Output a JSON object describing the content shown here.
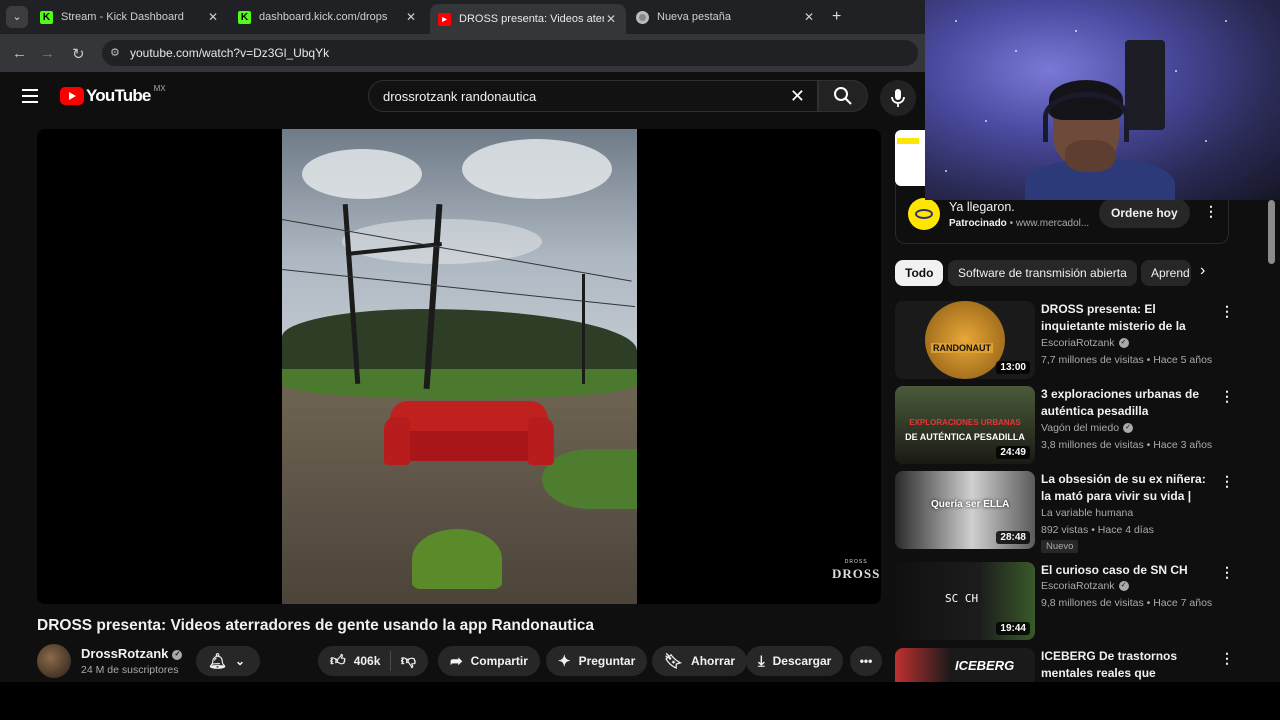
{
  "browser": {
    "tabs": [
      {
        "title": "Stream - Kick Dashboard",
        "favicon": "kick-icon",
        "active": false
      },
      {
        "title": "dashboard.kick.com/drops",
        "favicon": "kick-icon",
        "active": false
      },
      {
        "title": "DROSS presenta: Videos aterradores",
        "favicon": "youtube-icon",
        "active": true
      },
      {
        "title": "Nueva pestaña",
        "favicon": "chrome-icon",
        "active": false
      }
    ],
    "url": "youtube.com/watch?v=Dz3Gl_UbqYk"
  },
  "youtube": {
    "logo_text": "YouTube",
    "country_code": "MX",
    "search_query": "drossrotzank randonautica",
    "video": {
      "title": "DROSS presenta: Videos aterradores de gente usando la app Randonautica",
      "channel": "DrossRotzank",
      "subscribers": "24 M de suscriptores",
      "likes": "406k",
      "watermark_small": "DROSS",
      "watermark_big": "DROSS"
    },
    "actions": {
      "share": "Compartir",
      "ask": "Preguntar",
      "save": "Ahorrar",
      "download": "Descargar"
    },
    "ad": {
      "title": "Ya llegaron.",
      "sponsored": "Patrocinado",
      "domain": "www.mercadol...",
      "cta": "Ordene hoy"
    },
    "chips": [
      "Todo",
      "Software de transmisión abierta",
      "Aprend"
    ],
    "recommendations": [
      {
        "title": "DROSS presenta: El inquietante misterio de la aplicación ...",
        "channel": "EscoriaRotzank",
        "verified": true,
        "meta": "7,7 millones de visitas • Hace 5 años",
        "duration": "13:00",
        "badge": ""
      },
      {
        "title": "3 exploraciones urbanas de auténtica pesadilla",
        "channel": "Vagón del miedo",
        "verified": true,
        "meta": "3,8 millones de visitas • Hace 3 años",
        "duration": "24:49",
        "badge": ""
      },
      {
        "title": "La obsesión de su ex niñera: la mató para vivir su vida | Caso ...",
        "channel": "La variable humana",
        "verified": false,
        "meta": "892 vistas • Hace 4 días",
        "duration": "28:48",
        "badge": "Nuevo"
      },
      {
        "title": "El curioso caso de SN CH",
        "channel": "EscoriaRotzank",
        "verified": true,
        "meta": "9,8 millones de visitas • Hace 7 años",
        "duration": "19:44",
        "badge": ""
      },
      {
        "title": "ICEBERG De trastornos mentales reales que destruyen...",
        "channel": "",
        "verified": false,
        "meta": "",
        "duration": "",
        "badge": ""
      }
    ],
    "thumb_texts": {
      "t1_top": "RANDONAUT",
      "t2_top": "EXPLORACIONES URBANAS",
      "t2_bottom": "DE AUTÉNTICA PESADILLA",
      "t3": "Quería ser ELLA",
      "t4": "SC CH",
      "t5": "ICEBERG"
    }
  },
  "colors": {
    "yt_red": "#ff0000",
    "kick_green": "#53fc18",
    "bg": "#0f0f0f"
  }
}
